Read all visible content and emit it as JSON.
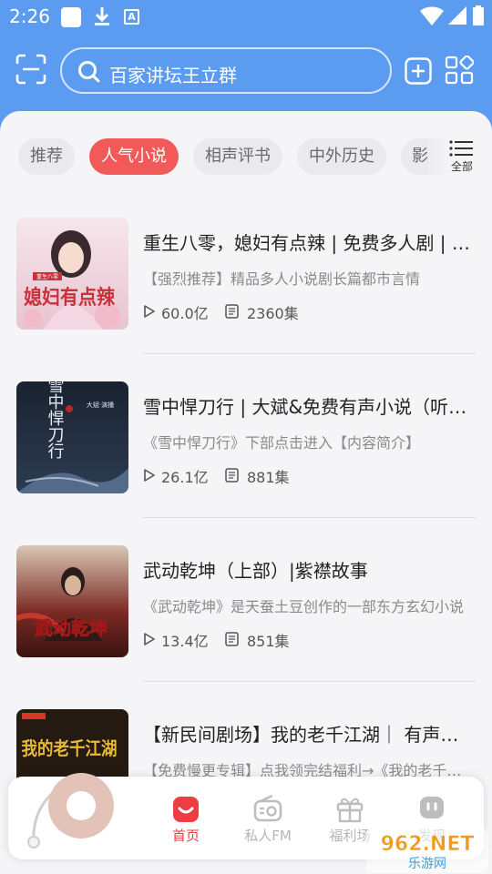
{
  "status_bar": {
    "time": "2:26",
    "a_label": "A"
  },
  "header": {
    "search_text": "百家讲坛王立群"
  },
  "categories": {
    "chips": [
      "推荐",
      "人气小说",
      "相声评书",
      "中外历史",
      "影"
    ],
    "active_index": 1,
    "all_label": "全部"
  },
  "books": [
    {
      "title": "重生八零，媳妇有点辣 | 免费多人剧 | 多人有声剧",
      "desc": "【强烈推荐】精品多人小说剧长篇都市言情",
      "plays": "60.0亿",
      "episodes": "2360集",
      "cover_text": "媳妇有点辣",
      "cover_tag": "重生八零"
    },
    {
      "title": "雪中悍刀行 | 大斌&免费有声小说（听书）",
      "desc": "《雪中悍刀行》下部点击进入【内容简介】",
      "plays": "26.1亿",
      "episodes": "881集",
      "cover_text": "雪中悍刀行",
      "cover_tag": "大斌·演播"
    },
    {
      "title": "武动乾坤（上部）|紫襟故事",
      "desc": "《武动乾坤》是天蚕土豆创作的一部东方玄幻小说",
      "plays": "13.4亿",
      "episodes": "851集",
      "cover_text": "武动乾坤"
    },
    {
      "title": "【新民间剧场】我的老千江湖｜ 有声小说",
      "desc": "【免费慢更专辑】点我领完结福利→《我的老千江湖》",
      "plays": "",
      "episodes": "",
      "cover_text": "我的老千江湖"
    }
  ],
  "nav": {
    "items": [
      "首页",
      "私人FM",
      "福利场",
      "发现"
    ],
    "active_index": 0
  },
  "watermark": {
    "main": "962.NET",
    "sub": "乐游网"
  },
  "colors": {
    "brand_blue": "#5b9cf0",
    "accent_red": "#f15a58",
    "nav_active": "#ee3d43"
  }
}
